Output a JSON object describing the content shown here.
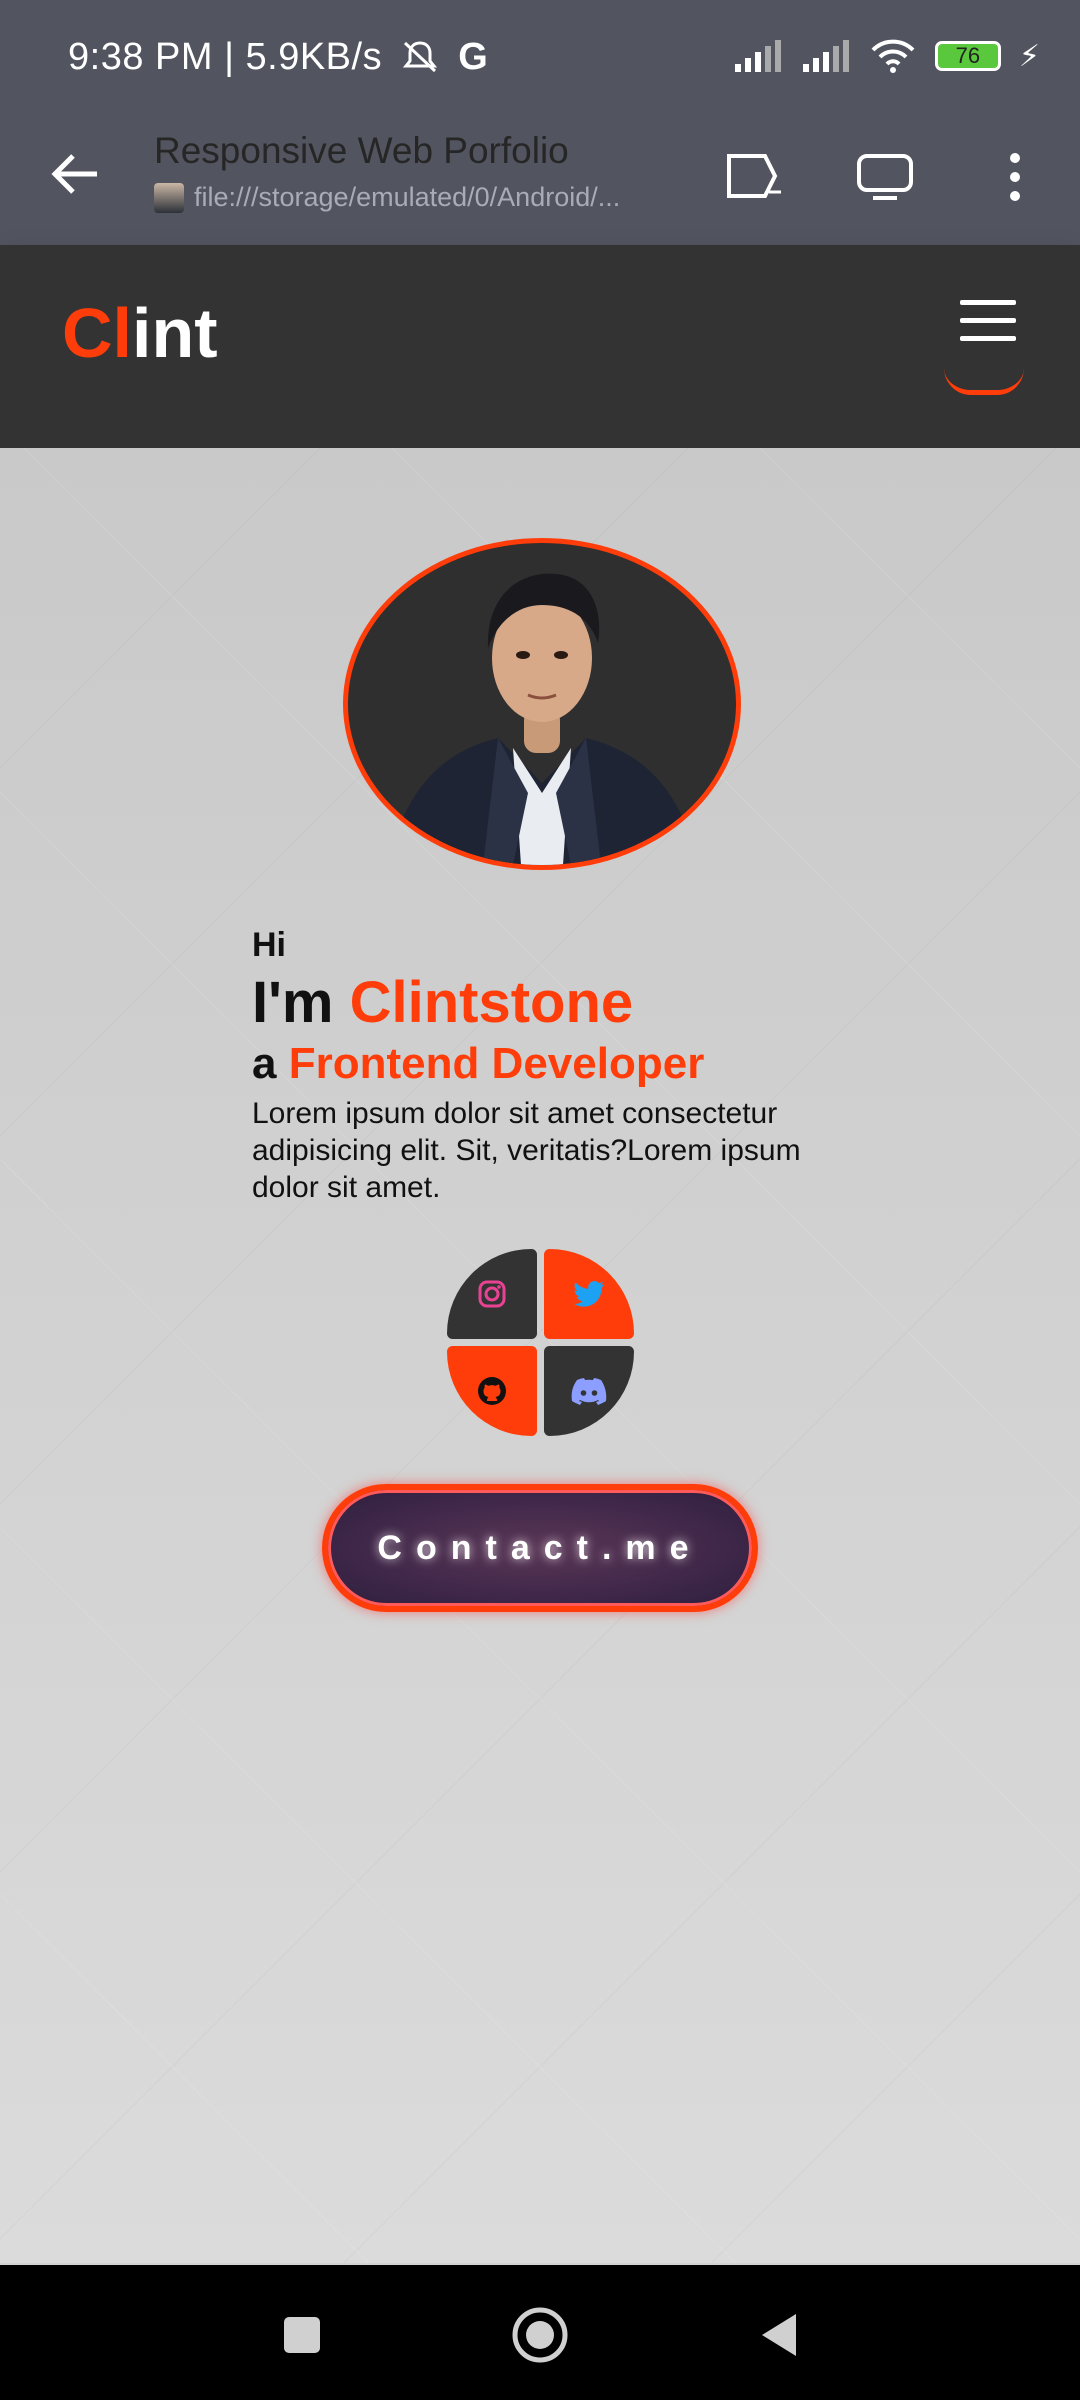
{
  "status_bar": {
    "time": "9:38 PM | 5.9KB/s",
    "battery": "76"
  },
  "browser": {
    "title": "Responsive Web Porfolio",
    "url": "file:///storage/emulated/0/Android/..."
  },
  "site": {
    "logo_accent": "Cl",
    "logo_rest": "int"
  },
  "hero": {
    "greeting": "Hi",
    "name_prefix": "I'm ",
    "name": "Clintstone",
    "role_prefix": "a ",
    "role": "Frontend Developer",
    "description": "Lorem ipsum dolor sit amet consectetur adipisicing elit. Sit, veritatis?Lorem ipsum dolor sit amet.",
    "contact_label": "Contact.me"
  },
  "socials": [
    "instagram-icon",
    "twitter-icon",
    "github-icon",
    "discord-icon"
  ],
  "colors": {
    "accent": "#ff3d0a",
    "dark": "#333333",
    "status_bg": "#52555f"
  }
}
